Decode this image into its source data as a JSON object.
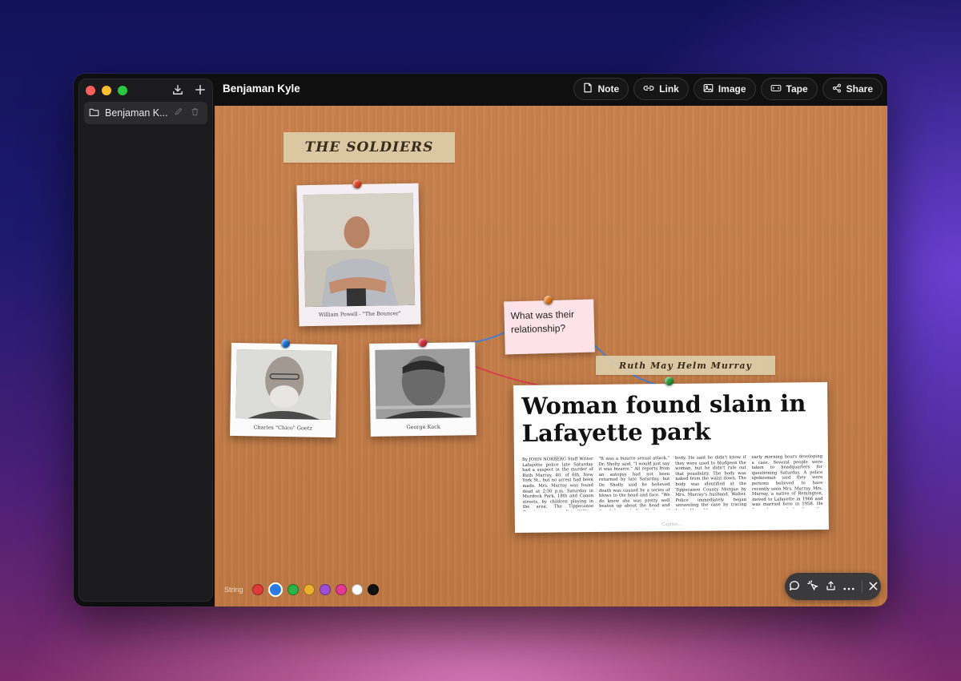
{
  "window": {
    "title": "Benjaman Kyle"
  },
  "sidebar": {
    "items": [
      {
        "label": "Benjaman K..."
      }
    ]
  },
  "toolbar": {
    "note_label": "Note",
    "link_label": "Link",
    "image_label": "Image",
    "tape_label": "Tape",
    "share_label": "Share"
  },
  "board": {
    "labels": {
      "soldiers": "The Soldiers",
      "ruth": "Ruth May Helm Murray"
    },
    "photos": [
      {
        "caption": "William Powell - \"The Bouncer\"",
        "pin_color": "#e0462a"
      },
      {
        "caption": "Charles \"Chico\" Goetz",
        "pin_color": "#1e6fd6"
      },
      {
        "caption": "George Kock",
        "pin_color": "#d8323a"
      }
    ],
    "note": {
      "text": "What was their relationship?",
      "pin_color": "#e67a1f"
    },
    "clipping": {
      "headline": "Woman found slain in Lafayette park",
      "caption_placeholder": "Caption...",
      "pin_color": "#2e9a3a",
      "columns": [
        "By JOHN NORBERG Staff Writer Lafayette police late Saturday had a suspect in the murder of Ruth Murray, 40, of 6th, New York St., but no arrest had been made. Mrs. Murray was found dead at 2:30 p.m. Saturday in Murdock Park, 18th and Canon streets, by children playing in the area. The Tippecanoe County coroner, Dr. William Sholty, said the body had been in the park near Kennedy Field for less than 28 hours and the murder was a sexual attack.",
        "\"It was a bizarre sexual attack,\" Dr. Sholty said. \"I would just say it was bizarre.\" All reports from an autopsy had not been returned by late Saturday, but Dr. Sholty said he believed death was caused by a series of blows to the head and face. \"We do know she was pretty well beaten up about the head and face,\" he said. Dr. Sholty said tree limbs as large as six to seven inches in diameter were found near the body.",
        "body. He said he didn't know if they were used to bludgeon the woman, but he didn't rule out that possibility. The body was naked from the waist down. The body was identified at the Tippecanoe County Morgue by Mrs. Murray's husband, Walter. Police immediately began unraveling the case by tracing back Mrs. Murray's steps to determine who had last seen her alive.",
        "early morning hours developing a case. Several people were taken to headquarters for questioning Saturday. A police spokesman said they were persons believed to have recently seen Mrs. Murray. Mrs. Murray, a native of Remington, moved to Lafayette in 1966 and was married here in 1958. He formerly worked for the Lafayette Street Department and Mrs. Murray formerly worked as a maid at St. Elizabeth Hospital."
      ]
    }
  },
  "string_palette": {
    "label": "String",
    "colors": [
      "#e03a3a",
      "#2a7be4",
      "#2bb34a",
      "#e8b12a",
      "#9a4fd8",
      "#e23a8e",
      "#ffffff",
      "#111111"
    ],
    "selected_index": 1
  },
  "traffic_lights": [
    "#ff5f57",
    "#febc2e",
    "#28c840"
  ]
}
